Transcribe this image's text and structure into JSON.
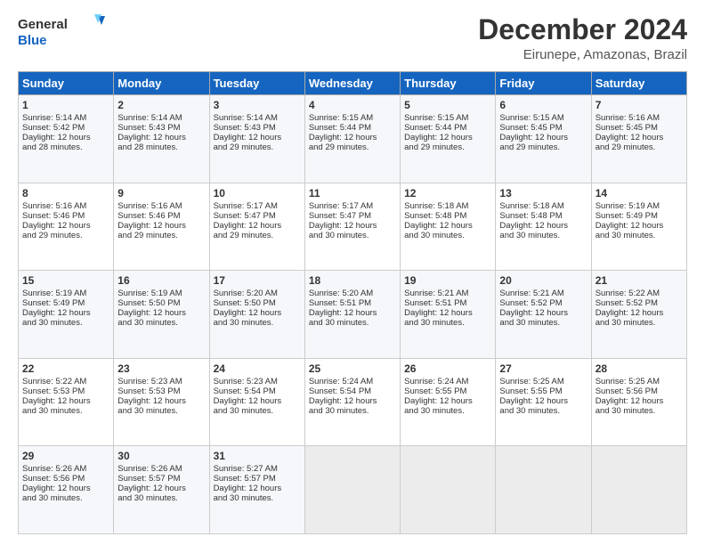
{
  "header": {
    "logo_line1": "General",
    "logo_line2": "Blue",
    "main_title": "December 2024",
    "sub_title": "Eirunepe, Amazonas, Brazil"
  },
  "calendar": {
    "days_of_week": [
      "Sunday",
      "Monday",
      "Tuesday",
      "Wednesday",
      "Thursday",
      "Friday",
      "Saturday"
    ],
    "weeks": [
      [
        {
          "day": "",
          "empty": true
        },
        {
          "day": "",
          "empty": true
        },
        {
          "day": "",
          "empty": true
        },
        {
          "day": "",
          "empty": true
        },
        {
          "day": "",
          "empty": true
        },
        {
          "day": "",
          "empty": true
        },
        {
          "day": "",
          "empty": true
        }
      ],
      [
        {
          "day": "1",
          "lines": [
            "Sunrise: 5:14 AM",
            "Sunset: 5:42 PM",
            "Daylight: 12 hours",
            "and 28 minutes."
          ]
        },
        {
          "day": "2",
          "lines": [
            "Sunrise: 5:14 AM",
            "Sunset: 5:43 PM",
            "Daylight: 12 hours",
            "and 28 minutes."
          ]
        },
        {
          "day": "3",
          "lines": [
            "Sunrise: 5:14 AM",
            "Sunset: 5:43 PM",
            "Daylight: 12 hours",
            "and 29 minutes."
          ]
        },
        {
          "day": "4",
          "lines": [
            "Sunrise: 5:15 AM",
            "Sunset: 5:44 PM",
            "Daylight: 12 hours",
            "and 29 minutes."
          ]
        },
        {
          "day": "5",
          "lines": [
            "Sunrise: 5:15 AM",
            "Sunset: 5:44 PM",
            "Daylight: 12 hours",
            "and 29 minutes."
          ]
        },
        {
          "day": "6",
          "lines": [
            "Sunrise: 5:15 AM",
            "Sunset: 5:45 PM",
            "Daylight: 12 hours",
            "and 29 minutes."
          ]
        },
        {
          "day": "7",
          "lines": [
            "Sunrise: 5:16 AM",
            "Sunset: 5:45 PM",
            "Daylight: 12 hours",
            "and 29 minutes."
          ]
        }
      ],
      [
        {
          "day": "8",
          "lines": [
            "Sunrise: 5:16 AM",
            "Sunset: 5:46 PM",
            "Daylight: 12 hours",
            "and 29 minutes."
          ]
        },
        {
          "day": "9",
          "lines": [
            "Sunrise: 5:16 AM",
            "Sunset: 5:46 PM",
            "Daylight: 12 hours",
            "and 29 minutes."
          ]
        },
        {
          "day": "10",
          "lines": [
            "Sunrise: 5:17 AM",
            "Sunset: 5:47 PM",
            "Daylight: 12 hours",
            "and 29 minutes."
          ]
        },
        {
          "day": "11",
          "lines": [
            "Sunrise: 5:17 AM",
            "Sunset: 5:47 PM",
            "Daylight: 12 hours",
            "and 30 minutes."
          ]
        },
        {
          "day": "12",
          "lines": [
            "Sunrise: 5:18 AM",
            "Sunset: 5:48 PM",
            "Daylight: 12 hours",
            "and 30 minutes."
          ]
        },
        {
          "day": "13",
          "lines": [
            "Sunrise: 5:18 AM",
            "Sunset: 5:48 PM",
            "Daylight: 12 hours",
            "and 30 minutes."
          ]
        },
        {
          "day": "14",
          "lines": [
            "Sunrise: 5:19 AM",
            "Sunset: 5:49 PM",
            "Daylight: 12 hours",
            "and 30 minutes."
          ]
        }
      ],
      [
        {
          "day": "15",
          "lines": [
            "Sunrise: 5:19 AM",
            "Sunset: 5:49 PM",
            "Daylight: 12 hours",
            "and 30 minutes."
          ]
        },
        {
          "day": "16",
          "lines": [
            "Sunrise: 5:19 AM",
            "Sunset: 5:50 PM",
            "Daylight: 12 hours",
            "and 30 minutes."
          ]
        },
        {
          "day": "17",
          "lines": [
            "Sunrise: 5:20 AM",
            "Sunset: 5:50 PM",
            "Daylight: 12 hours",
            "and 30 minutes."
          ]
        },
        {
          "day": "18",
          "lines": [
            "Sunrise: 5:20 AM",
            "Sunset: 5:51 PM",
            "Daylight: 12 hours",
            "and 30 minutes."
          ]
        },
        {
          "day": "19",
          "lines": [
            "Sunrise: 5:21 AM",
            "Sunset: 5:51 PM",
            "Daylight: 12 hours",
            "and 30 minutes."
          ]
        },
        {
          "day": "20",
          "lines": [
            "Sunrise: 5:21 AM",
            "Sunset: 5:52 PM",
            "Daylight: 12 hours",
            "and 30 minutes."
          ]
        },
        {
          "day": "21",
          "lines": [
            "Sunrise: 5:22 AM",
            "Sunset: 5:52 PM",
            "Daylight: 12 hours",
            "and 30 minutes."
          ]
        }
      ],
      [
        {
          "day": "22",
          "lines": [
            "Sunrise: 5:22 AM",
            "Sunset: 5:53 PM",
            "Daylight: 12 hours",
            "and 30 minutes."
          ]
        },
        {
          "day": "23",
          "lines": [
            "Sunrise: 5:23 AM",
            "Sunset: 5:53 PM",
            "Daylight: 12 hours",
            "and 30 minutes."
          ]
        },
        {
          "day": "24",
          "lines": [
            "Sunrise: 5:23 AM",
            "Sunset: 5:54 PM",
            "Daylight: 12 hours",
            "and 30 minutes."
          ]
        },
        {
          "day": "25",
          "lines": [
            "Sunrise: 5:24 AM",
            "Sunset: 5:54 PM",
            "Daylight: 12 hours",
            "and 30 minutes."
          ]
        },
        {
          "day": "26",
          "lines": [
            "Sunrise: 5:24 AM",
            "Sunset: 5:55 PM",
            "Daylight: 12 hours",
            "and 30 minutes."
          ]
        },
        {
          "day": "27",
          "lines": [
            "Sunrise: 5:25 AM",
            "Sunset: 5:55 PM",
            "Daylight: 12 hours",
            "and 30 minutes."
          ]
        },
        {
          "day": "28",
          "lines": [
            "Sunrise: 5:25 AM",
            "Sunset: 5:56 PM",
            "Daylight: 12 hours",
            "and 30 minutes."
          ]
        }
      ],
      [
        {
          "day": "29",
          "lines": [
            "Sunrise: 5:26 AM",
            "Sunset: 5:56 PM",
            "Daylight: 12 hours",
            "and 30 minutes."
          ]
        },
        {
          "day": "30",
          "lines": [
            "Sunrise: 5:26 AM",
            "Sunset: 5:57 PM",
            "Daylight: 12 hours",
            "and 30 minutes."
          ]
        },
        {
          "day": "31",
          "lines": [
            "Sunrise: 5:27 AM",
            "Sunset: 5:57 PM",
            "Daylight: 12 hours",
            "and 30 minutes."
          ]
        },
        {
          "day": "",
          "empty": true
        },
        {
          "day": "",
          "empty": true
        },
        {
          "day": "",
          "empty": true
        },
        {
          "day": "",
          "empty": true
        }
      ]
    ]
  }
}
